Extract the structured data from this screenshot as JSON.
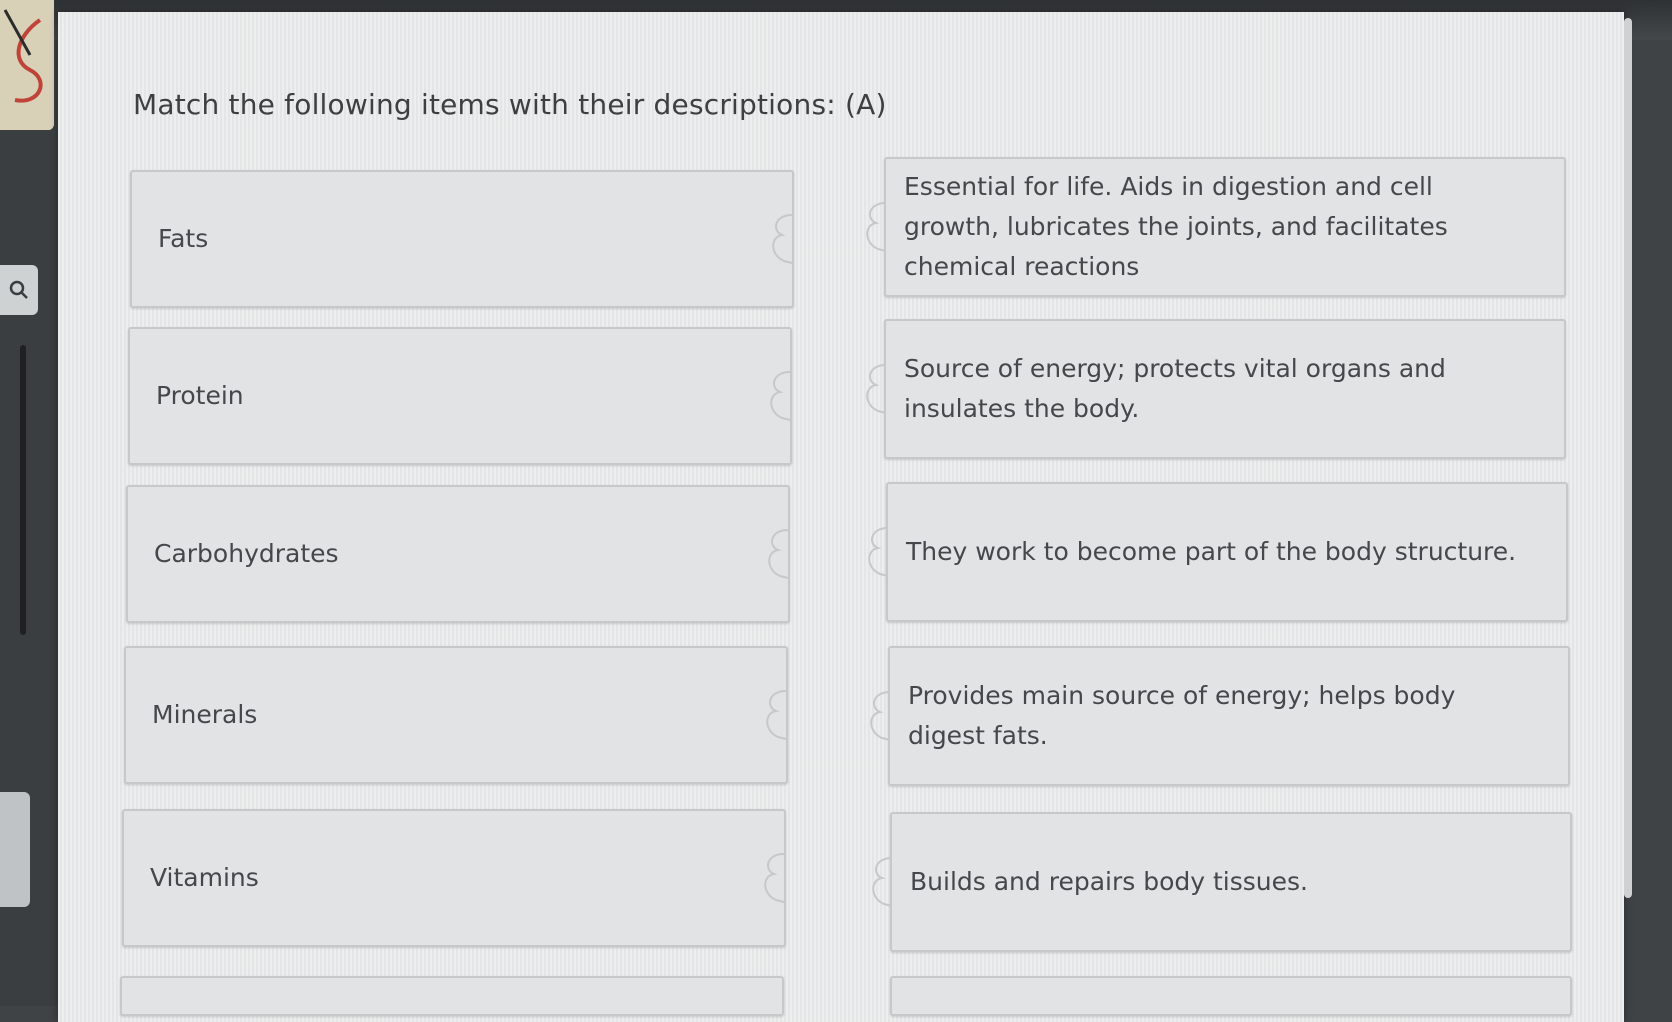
{
  "question": {
    "title": "Match the following items with their descriptions: (A)"
  },
  "terms": [
    {
      "label": "Fats"
    },
    {
      "label": "Protein"
    },
    {
      "label": "Carbohydrates"
    },
    {
      "label": "Minerals"
    },
    {
      "label": "Vitamins"
    }
  ],
  "descriptions": [
    {
      "text": "Essential for life. Aids in digestion and cell growth, lubricates the joints, and facilitates chemical reactions"
    },
    {
      "text": "Source of energy; protects vital organs and insulates the body."
    },
    {
      "text": "They work to become part of the body structure."
    },
    {
      "text": "Provides main source of energy; helps body digest fats."
    },
    {
      "text": "Builds and repairs body tissues."
    }
  ],
  "icons": {
    "search": "search-icon",
    "connector": "puzzle-connector-icon",
    "logo": "app-logo"
  },
  "colors": {
    "panel": "#e9eaeb",
    "card": "#e2e3e4",
    "card_border": "#c6c8c9",
    "text": "#45484a"
  }
}
